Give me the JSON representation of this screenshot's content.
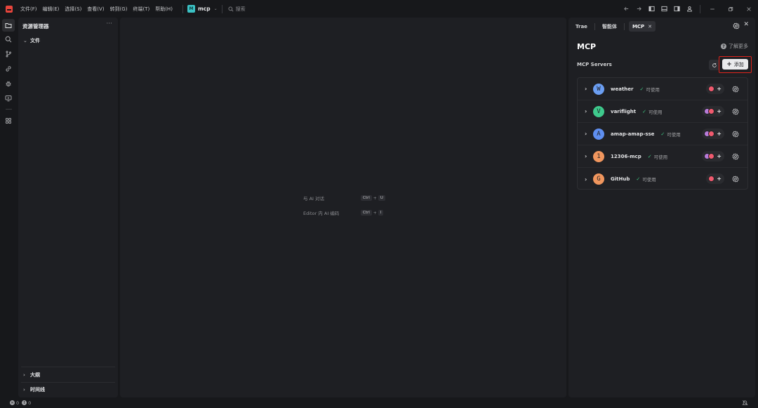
{
  "menu": [
    "文件(F)",
    "编辑(E)",
    "选择(S)",
    "查看(V)",
    "转到(G)",
    "终端(T)",
    "帮助(H)"
  ],
  "project": {
    "initial": "M",
    "name": "mcp"
  },
  "search": {
    "label": "搜索"
  },
  "explorer": {
    "title": "资源管理器",
    "more": "···",
    "sections": {
      "files": "文件",
      "outline": "大纲",
      "timeline": "时间线"
    }
  },
  "editor": {
    "hints": [
      {
        "label": "与 AI 对话",
        "mod": "Ctrl",
        "key": "U"
      },
      {
        "label": "Editor 内 AI 编码",
        "mod": "Ctrl",
        "key": "I"
      }
    ]
  },
  "panel": {
    "tabs": [
      "Trae",
      "智能体",
      "MCP"
    ],
    "title": "MCP",
    "learn_more": "了解更多",
    "servers_label": "MCP Servers",
    "add_label": "添加",
    "status_text": "可使用",
    "servers": [
      {
        "initial": "W",
        "name": "weather",
        "color": "#6b9ef2",
        "agents": [
          "pink"
        ]
      },
      {
        "initial": "V",
        "name": "variflight",
        "color": "#3ec98c",
        "agents": [
          "purple",
          "pink"
        ]
      },
      {
        "initial": "A",
        "name": "amap-amap-sse",
        "color": "#5f8ff0",
        "agents": [
          "purple",
          "pink"
        ]
      },
      {
        "initial": "1",
        "name": "12306-mcp",
        "color": "#f0965e",
        "agents": [
          "purple",
          "pink"
        ]
      },
      {
        "initial": "G",
        "name": "GitHub",
        "color": "#f0965e",
        "agents": [
          "pink"
        ]
      }
    ]
  },
  "statusbar": {
    "errors": "0",
    "warnings": "0"
  }
}
